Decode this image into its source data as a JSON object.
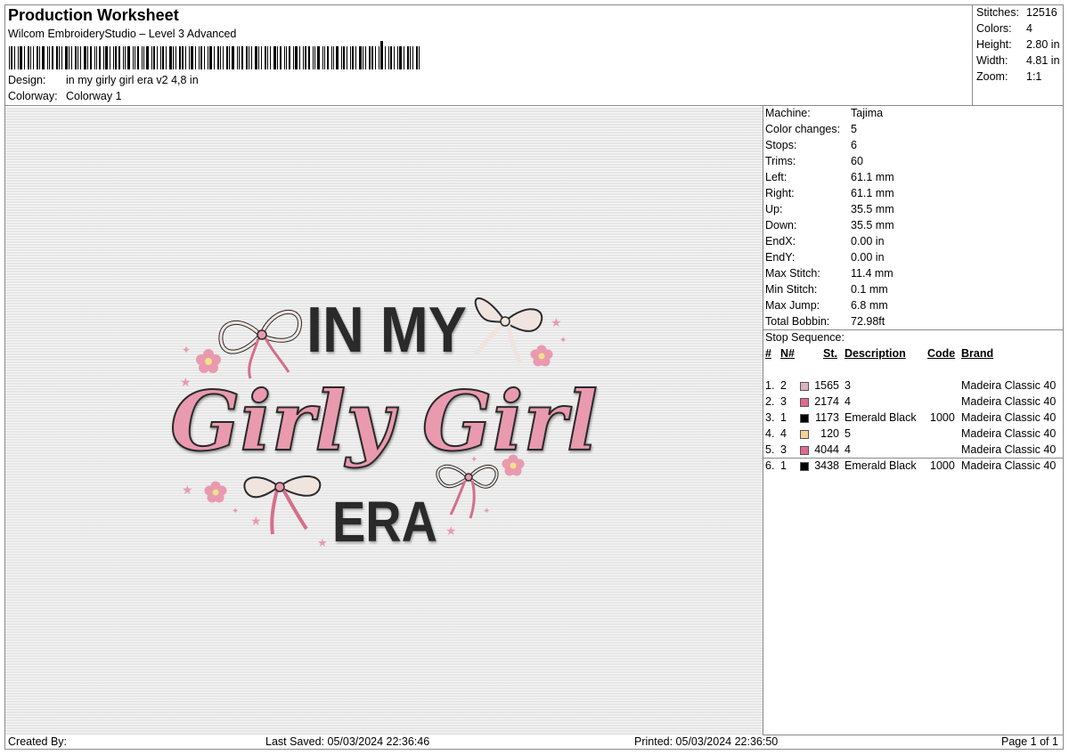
{
  "header": {
    "title": "Production Worksheet",
    "software": "Wilcom EmbroideryStudio – Level 3 Advanced",
    "design_label": "Design:",
    "design_value": "in my girly girl era  v2 4,8 in",
    "colorway_label": "Colorway:",
    "colorway_value": "Colorway 1"
  },
  "summary": [
    {
      "label": "Stitches:",
      "value": "12516"
    },
    {
      "label": "Colors:",
      "value": "4"
    },
    {
      "label": "Height:",
      "value": "2.80 in"
    },
    {
      "label": "Width:",
      "value": "4.81 in"
    },
    {
      "label": "Zoom:",
      "value": "1:1"
    }
  ],
  "machine_info": [
    {
      "label": "Machine:",
      "value": "Tajima"
    },
    {
      "label": "Color changes:",
      "value": "5"
    },
    {
      "label": "Stops:",
      "value": "6"
    },
    {
      "label": "Trims:",
      "value": "60"
    },
    {
      "label": "Left:",
      "value": "61.1 mm"
    },
    {
      "label": "Right:",
      "value": "61.1 mm"
    },
    {
      "label": "Up:",
      "value": "35.5 mm"
    },
    {
      "label": "Down:",
      "value": "35.5 mm"
    },
    {
      "label": "EndX:",
      "value": "0.00 in"
    },
    {
      "label": "EndY:",
      "value": "0.00 in"
    },
    {
      "label": "Max Stitch:",
      "value": "11.4 mm"
    },
    {
      "label": "Min Stitch:",
      "value": "0.1 mm"
    },
    {
      "label": "Max Jump:",
      "value": "6.8 mm"
    },
    {
      "label": "Total Bobbin:",
      "value": "72.98ft"
    }
  ],
  "stop_sequence": {
    "title": "Stop Sequence:",
    "headers": {
      "num": "#",
      "n": "N#",
      "st": "St.",
      "description": "Description",
      "code": "Code",
      "brand": "Brand"
    },
    "rows": [
      {
        "num": "1.",
        "n": "2",
        "color": "#d9b3bd",
        "st": "1565",
        "description": "3",
        "code": "",
        "brand": "Madeira Classic 40"
      },
      {
        "num": "2.",
        "n": "3",
        "color": "#e06a8e",
        "st": "2174",
        "description": "4",
        "code": "",
        "brand": "Madeira Classic 40"
      },
      {
        "num": "3.",
        "n": "1",
        "color": "#000000",
        "st": "1173",
        "description": "Emerald Black",
        "code": "1000",
        "brand": "Madeira Classic 40"
      },
      {
        "num": "4.",
        "n": "4",
        "color": "#f5d49a",
        "st": "120",
        "description": "5",
        "code": "",
        "brand": "Madeira Classic 40"
      },
      {
        "num": "5.",
        "n": "3",
        "color": "#e06a8e",
        "st": "4044",
        "description": "4",
        "code": "",
        "brand": "Madeira Classic 40"
      },
      {
        "num": "6.",
        "n": "1",
        "color": "#000000",
        "st": "3438",
        "description": "Emerald Black",
        "code": "1000",
        "brand": "Madeira Classic 40"
      }
    ]
  },
  "design": {
    "line1": "IN MY",
    "line2": "Girly Girl",
    "line3": "ERA",
    "colors": {
      "black": "#2a2a2a",
      "pink": "#e99aae",
      "pink_dark": "#d46f8c",
      "cream": "#efe4de",
      "yellow": "#f3e08a"
    }
  },
  "footer": {
    "created_by": "Created By:",
    "last_saved": "Last Saved: 05/03/2024 22:36:46",
    "printed": "Printed: 05/03/2024 22:36:50",
    "page": "Page 1 of 1"
  }
}
